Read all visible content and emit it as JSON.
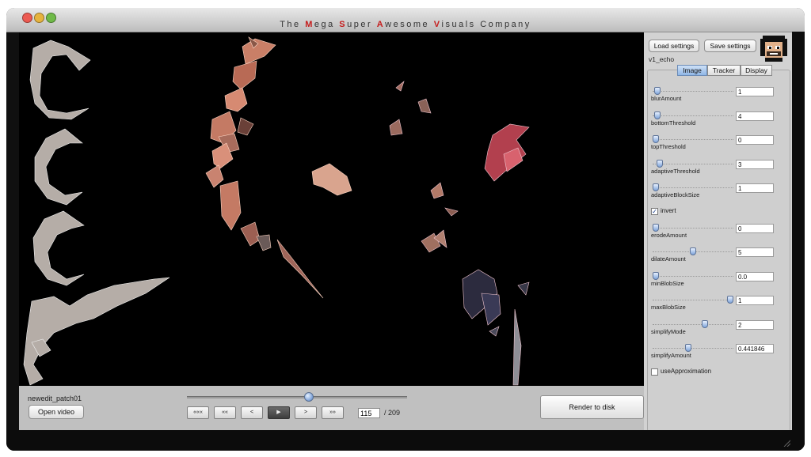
{
  "window": {
    "title_segments": [
      {
        "text": "The ",
        "accent": false
      },
      {
        "text": "M",
        "accent": true
      },
      {
        "text": "ega ",
        "accent": false
      },
      {
        "text": "S",
        "accent": true
      },
      {
        "text": "uper ",
        "accent": false
      },
      {
        "text": "A",
        "accent": true
      },
      {
        "text": "wesome ",
        "accent": false
      },
      {
        "text": "V",
        "accent": true
      },
      {
        "text": "isuals Company",
        "accent": false
      }
    ],
    "accent_color": "#c51c1c"
  },
  "bottom": {
    "patch_name": "newedit_patch01",
    "open_video_label": "Open video",
    "transport": [
      {
        "label": "«««",
        "name": "skip-start-button"
      },
      {
        "label": "««",
        "name": "rewind-button"
      },
      {
        "label": "<",
        "name": "step-back-button"
      },
      {
        "label": "▶",
        "name": "play-button",
        "active": true
      },
      {
        "label": ">",
        "name": "step-forward-button"
      },
      {
        "label": "»»",
        "name": "fast-forward-button"
      }
    ],
    "current_frame": "115",
    "total_frames": "/ 209",
    "render_label": "Render to disk"
  },
  "panel": {
    "load_label": "Load settings",
    "save_label": "Save settings",
    "settings_name": "v1_echo",
    "tabs": [
      {
        "label": "Image",
        "selected": true
      },
      {
        "label": "Tracker",
        "selected": false
      },
      {
        "label": "Display",
        "selected": false
      }
    ],
    "params": [
      {
        "label": "blurAmount",
        "value": "1",
        "level": 0.02
      },
      {
        "label": "bottomThreshold",
        "value": "4",
        "level": 0.02
      },
      {
        "label": "topThreshold",
        "value": "0",
        "level": 0.0
      },
      {
        "label": "adaptiveThreshold",
        "value": "3",
        "level": 0.05
      },
      {
        "label": "adaptiveBlockSize",
        "value": "1",
        "level": 0.0
      },
      {
        "checkbox": true,
        "label": "invert",
        "checked": true
      },
      {
        "label": "erodeAmount",
        "value": "0",
        "level": 0.0
      },
      {
        "label": "dilateAmount",
        "value": "5",
        "level": 0.5
      },
      {
        "label": "minBlobSize",
        "value": "0.0",
        "level": 0.0
      },
      {
        "label": "maxBlobSize",
        "value": "1",
        "level": 1.0
      },
      {
        "label": "simplifyMode",
        "value": "2",
        "level": 0.66
      },
      {
        "label": "simplifyAmount",
        "value": "0.441846",
        "level": 0.44
      },
      {
        "checkbox": true,
        "label": "useApproximation",
        "checked": false
      }
    ]
  },
  "playback_position": 0.55
}
